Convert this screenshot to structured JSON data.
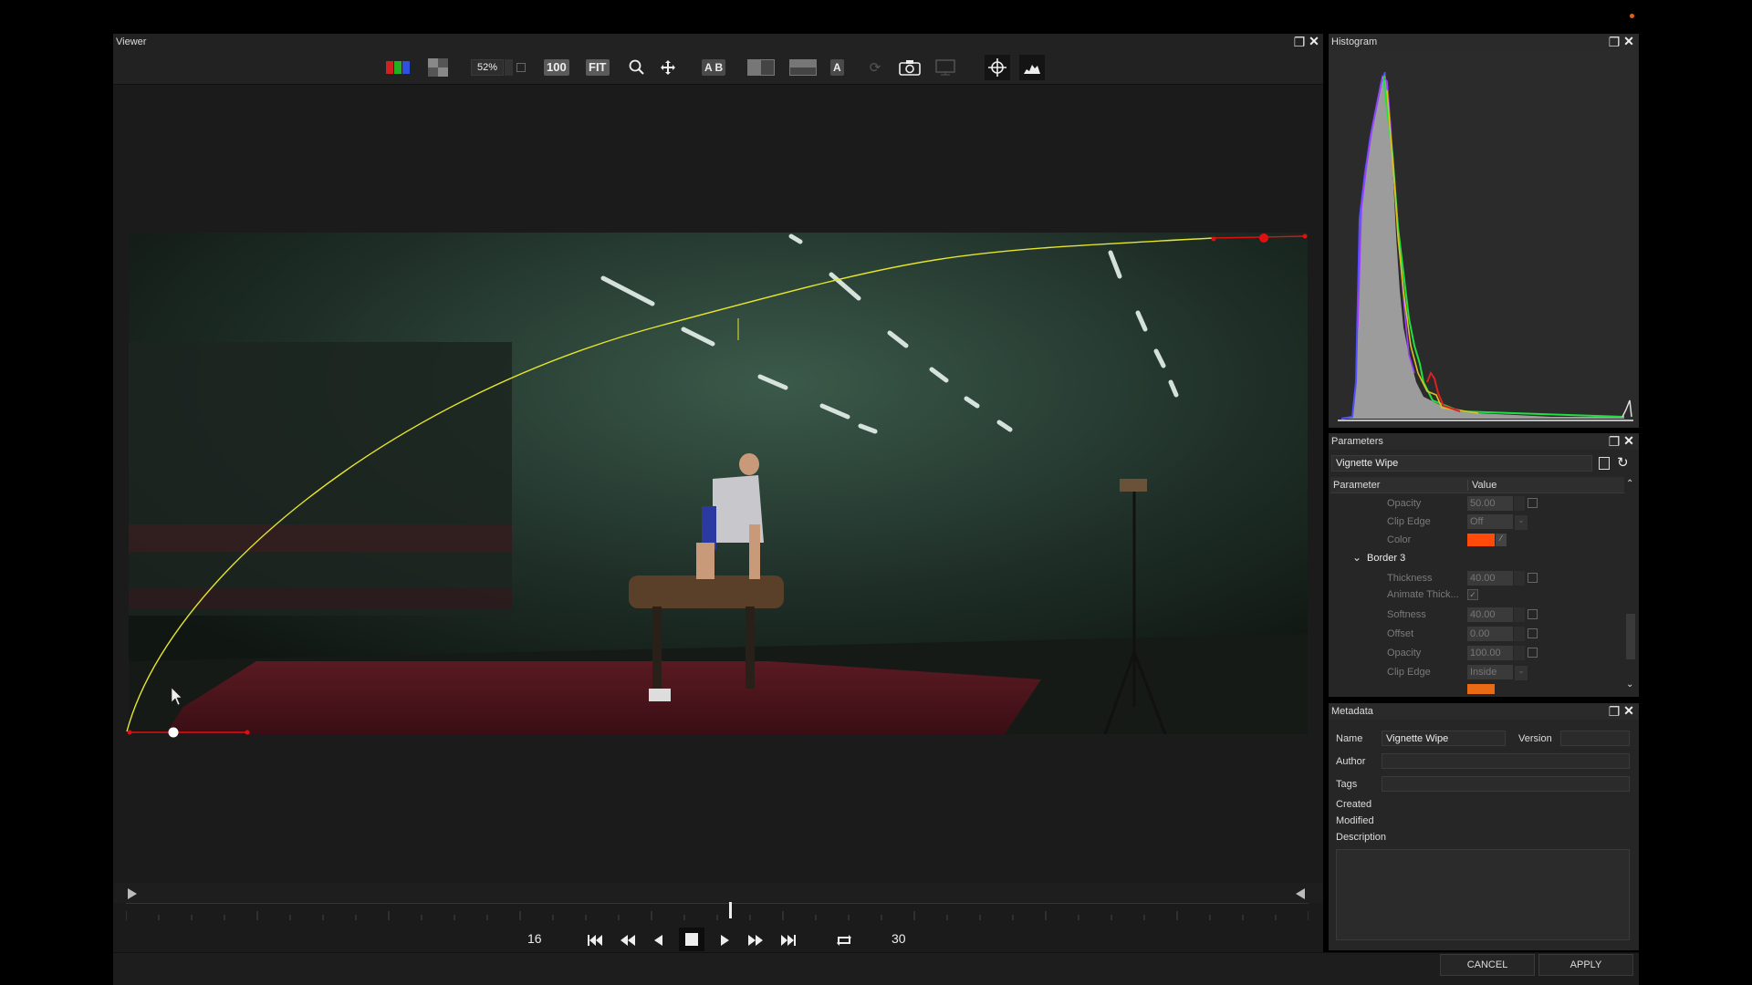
{
  "viewer": {
    "title": "Viewer",
    "toolbar": {
      "zoom_value": "52%",
      "btn_100": "100",
      "btn_fit": "FIT",
      "btn_ab": "A B",
      "btn_a": "A"
    },
    "transport": {
      "start_frame": "16",
      "end_frame": "30",
      "playhead_position": 0.51
    }
  },
  "histogram": {
    "title": "Histogram"
  },
  "parameters": {
    "title": "Parameters",
    "effect_name": "Vignette Wipe",
    "col_parameter": "Parameter",
    "col_value": "Value",
    "rows": [
      {
        "name": "Opacity",
        "value": "50.00"
      },
      {
        "name": "Clip Edge",
        "value": "Off"
      },
      {
        "name": "Color",
        "value": ""
      },
      {
        "name": "Thickness",
        "value": "40.00"
      },
      {
        "name": "Animate Thick...",
        "value": ""
      },
      {
        "name": "Softness",
        "value": "40.00"
      },
      {
        "name": "Offset",
        "value": "0.00"
      },
      {
        "name": "Opacity",
        "value": "100.00"
      },
      {
        "name": "Clip Edge",
        "value": "Inside"
      }
    ],
    "group_border3": "Border 3",
    "color_swatch": "#ff4a0a",
    "color_swatch_2": "#e86a14"
  },
  "metadata": {
    "title": "Metadata",
    "name_label": "Name",
    "name_value": "Vignette Wipe",
    "version_label": "Version",
    "version_value": "",
    "author_label": "Author",
    "author_value": "",
    "tags_label": "Tags",
    "tags_value": "",
    "created_label": "Created",
    "modified_label": "Modified",
    "description_label": "Description",
    "description_value": ""
  },
  "footer": {
    "cancel": "CANCEL",
    "apply": "APPLY"
  },
  "colors": {
    "curve": "#e6e62a",
    "keypoint": "#e01010",
    "accent_dot": "#e0601a"
  }
}
